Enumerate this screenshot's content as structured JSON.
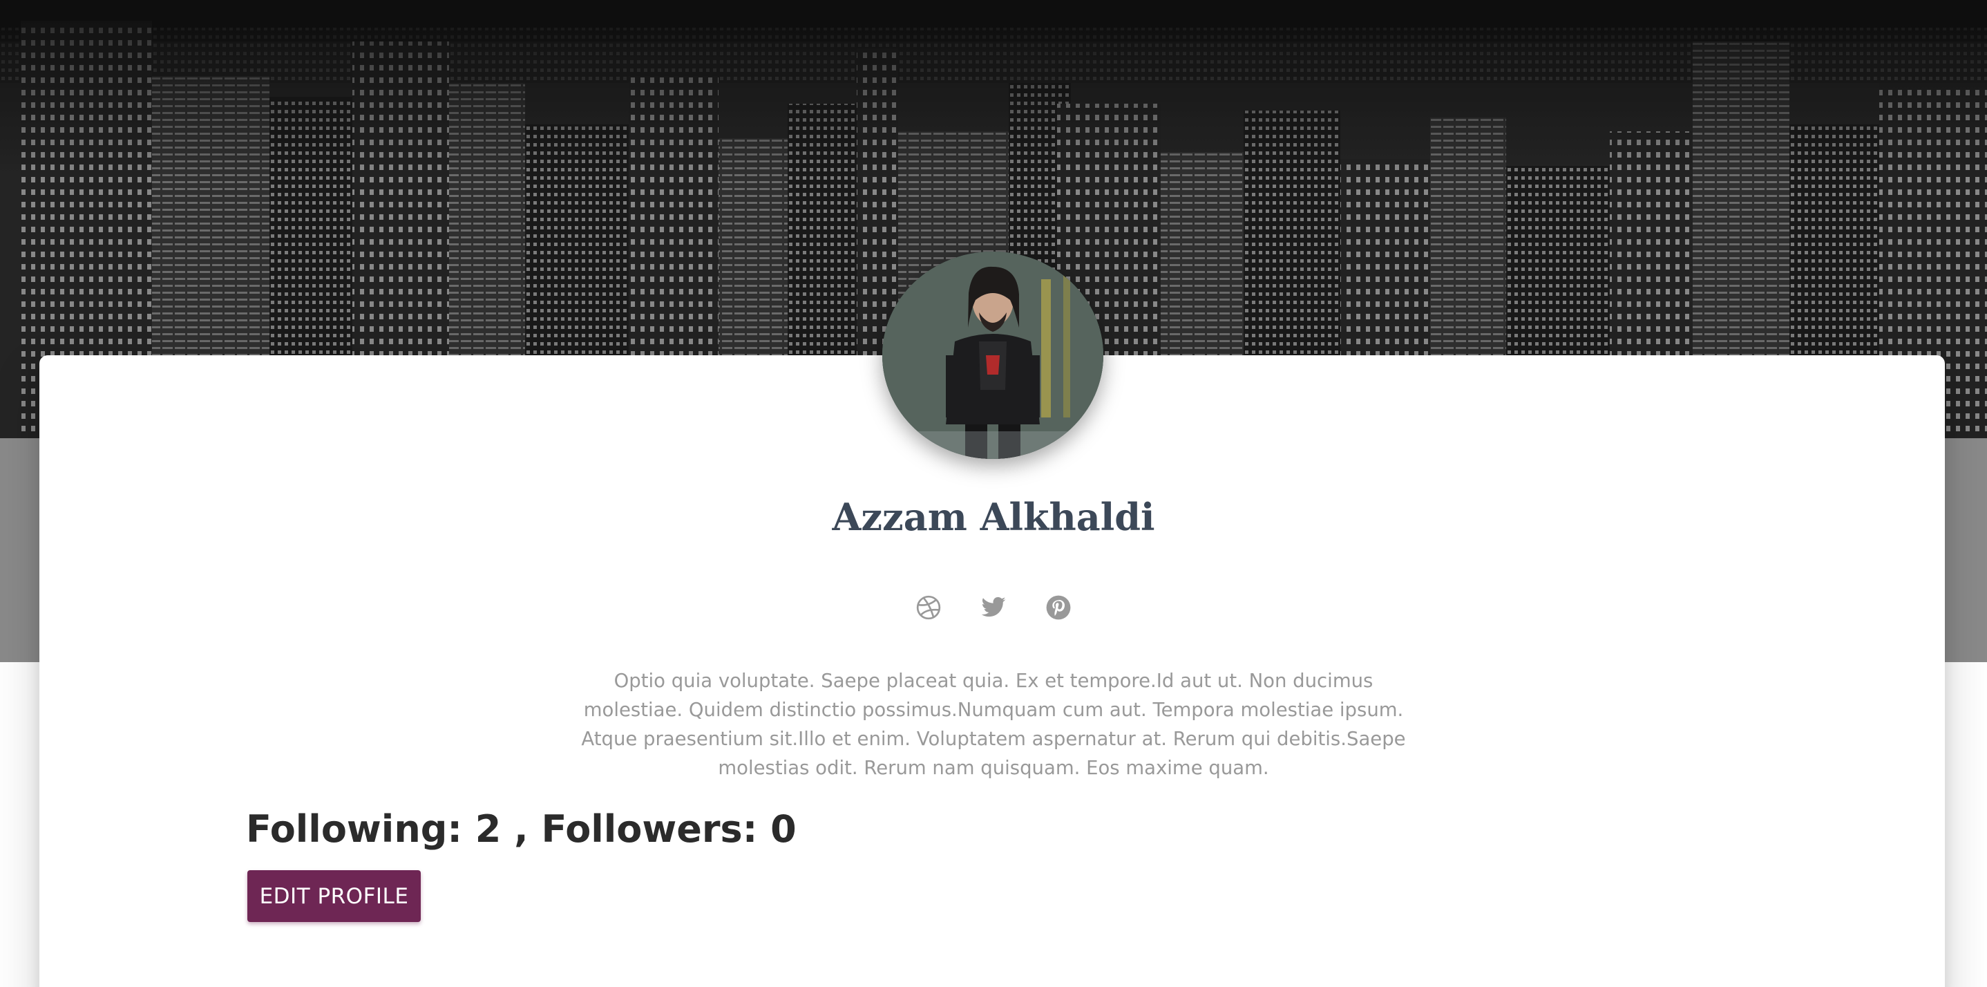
{
  "profile": {
    "name": "Azzam Alkhaldi",
    "bio": "Optio quia voluptate. Saepe placeat quia. Ex et tempore.Id aut ut. Non ducimus molestiae. Quidem distinctio possimus.Numquam cum aut. Tempora molestiae ipsum. Atque praesentium sit.Illo et enim. Voluptatem aspernatur at. Rerum qui debitis.Saepe molestias odit. Rerum nam quisquam. Eos maxime quam.",
    "stats": "Following: 2 , Followers: 0",
    "edit_button_label": "EDIT PROFILE"
  },
  "socials": [
    {
      "icon": "dribbble-icon"
    },
    {
      "icon": "twitter-icon"
    },
    {
      "icon": "pinterest-icon"
    }
  ],
  "colors": {
    "name": "#3c4858",
    "bio": "#999999",
    "icons": "#999999",
    "button": "#6e2654",
    "hero_lower": "#8a8a8a"
  }
}
